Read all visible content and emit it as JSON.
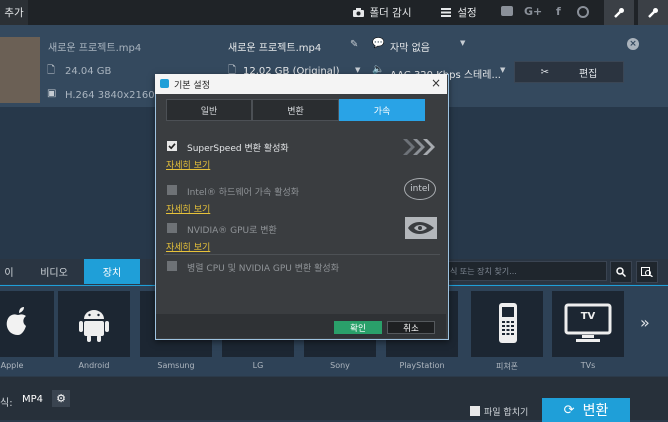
{
  "topbar": {
    "add_label": "추가",
    "folder_watch_label": "폴더 감시",
    "settings_label": "설정",
    "social": [
      "G+",
      "f"
    ]
  },
  "file": {
    "name": "새로운 프로젝트.mp4",
    "size": "24.04 GB",
    "codec": "H.264 3840x2160 3",
    "output_name": "새로운 프로젝트.mp4",
    "output_size": "12.02 GB (Original)",
    "subtitle": "자막 없음",
    "audio": "AAC 320 Kbps 스테레...",
    "edit_label": "편집"
  },
  "categories": {
    "items": [
      "이",
      "비디오",
      "장치"
    ],
    "active_index": 2,
    "search_placeholder": "식 또는 장치 찾기..."
  },
  "devices": [
    "Apple",
    "Android",
    "Samsung",
    "LG",
    "Sony",
    "PlayStation",
    "피쳐폰",
    "TVs"
  ],
  "tv_badge": "TV",
  "bottom": {
    "format_label": "식:",
    "format_value": "MP4",
    "merge_label": "파일 합치기",
    "convert_label": "변환"
  },
  "dialog": {
    "title": "기본 설정",
    "tabs": [
      "일반",
      "변환",
      "가속"
    ],
    "active_tab": 2,
    "options": [
      {
        "label": "SuperSpeed 변환 활성화",
        "checked": true,
        "enabled": true,
        "link": "자세히 보기"
      },
      {
        "label": "Intel® 하드웨어 가속 활성화",
        "checked": false,
        "enabled": false,
        "link": "자세히 보기"
      },
      {
        "label": "NVIDIA® GPU로 변환",
        "checked": false,
        "enabled": false,
        "link": "자세히 보기"
      },
      {
        "label": "병렬 CPU 및 NVIDIA GPU 변환 활성화",
        "checked": false,
        "enabled": false
      }
    ],
    "intel_logo_text": "intel",
    "ok_label": "확인",
    "cancel_label": "취소"
  },
  "colors": {
    "accent": "#1f9fd8",
    "link": "#e7c23a",
    "ok": "#2aa06a"
  }
}
